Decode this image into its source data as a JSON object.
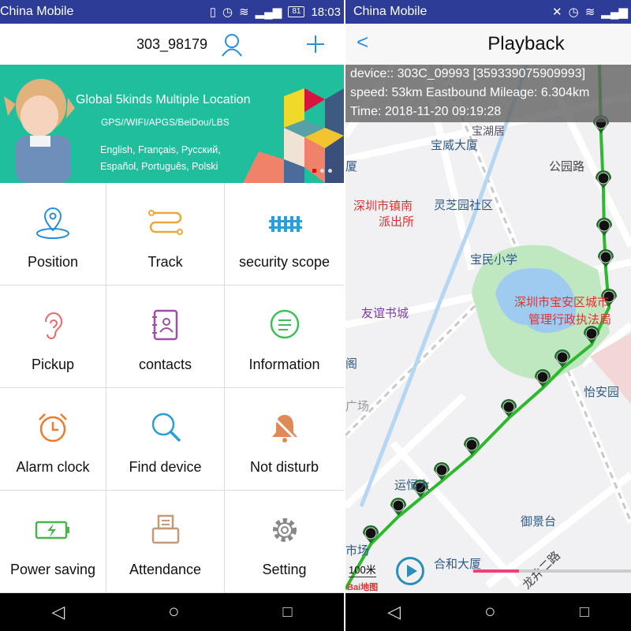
{
  "left": {
    "status": {
      "carrier": "China Mobile",
      "battery": "81",
      "time": "18:03"
    },
    "header": {
      "title": "303_98179",
      "user_icon": "user-icon",
      "add_icon": "plus-icon",
      "accent": "#2a8fd6"
    },
    "banner": {
      "headline": "Global 5kinds Multiple Location",
      "methods": "GPS//WIFI/APGS/BeiDou/LBS",
      "languages_line1": "English, Français, Русский,",
      "languages_line2": "Español, Português, Polski",
      "background": "#1fbf9e"
    },
    "menu": [
      {
        "label": "Position",
        "icon": "location-pin-icon"
      },
      {
        "label": "Track",
        "icon": "track-route-icon"
      },
      {
        "label": "security scope",
        "icon": "fence-icon"
      },
      {
        "label": "Pickup",
        "icon": "ear-icon"
      },
      {
        "label": "contacts",
        "icon": "contacts-book-icon"
      },
      {
        "label": "Information",
        "icon": "chat-bubble-icon"
      },
      {
        "label": "Alarm clock",
        "icon": "alarm-clock-icon"
      },
      {
        "label": "Find device",
        "icon": "magnifier-icon"
      },
      {
        "label": "Not disturb",
        "icon": "bell-muted-icon"
      },
      {
        "label": "Power saving",
        "icon": "battery-charging-icon"
      },
      {
        "label": "Attendance",
        "icon": "attendance-icon"
      },
      {
        "label": "Setting",
        "icon": "gear-icon"
      }
    ]
  },
  "right": {
    "status": {
      "carrier": "China Mobile"
    },
    "header": {
      "title": "Playback"
    },
    "info": {
      "device": "device::  303C_09993 [359339075909993]",
      "speed": "speed:  53km  Eastbound  Mileage: 6.304km",
      "time": "Time:  2018-11-20 09:19:28"
    },
    "map_labels": [
      "宝威大厦",
      "公园路",
      "深圳市镇南",
      "派出所",
      "灵芝园社区",
      "宝民小学",
      "友谊书城",
      "深圳市宝安区城市",
      "管理行政执法局",
      "怡安园",
      "运恒大",
      "御景台",
      "合和大厦",
      "龙井二路",
      "宝",
      "厦",
      "阁",
      "广场",
      "市场",
      "宝湖居"
    ],
    "scale": "100米",
    "map_logo": "Baidu地图",
    "playback_progress_percent": 29,
    "track_color": "#2db82d"
  },
  "nav": [
    "back",
    "home",
    "recent"
  ]
}
